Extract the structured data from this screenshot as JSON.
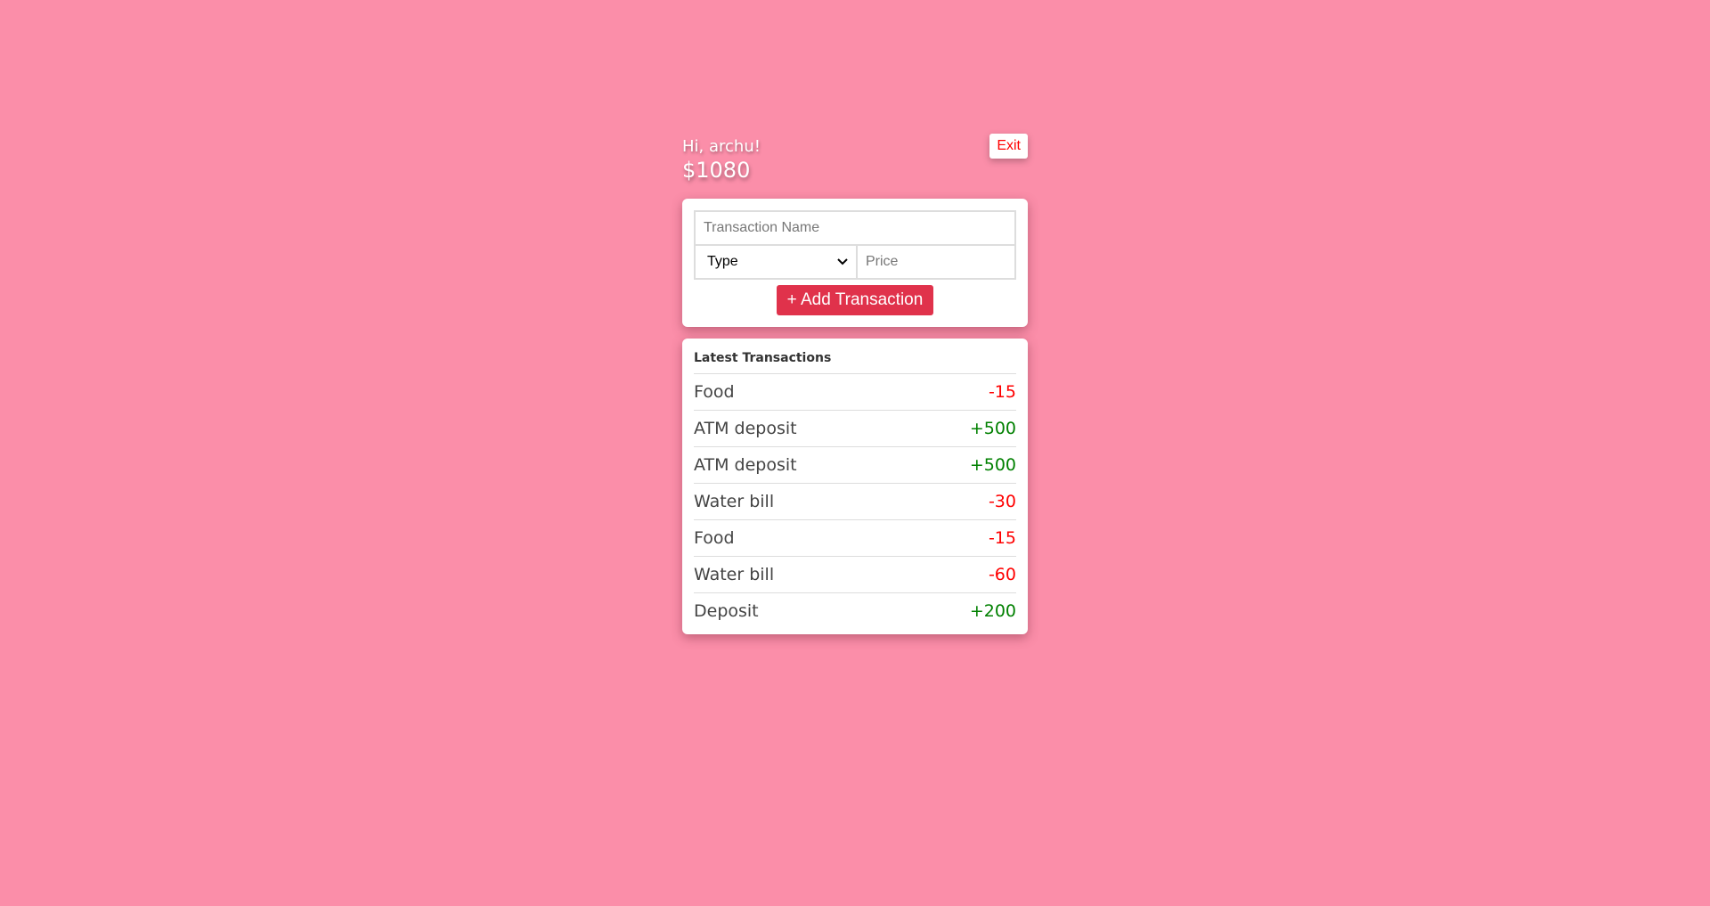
{
  "header": {
    "greeting": "Hi, archu!",
    "balance": "$1080",
    "exit_label": "Exit"
  },
  "form": {
    "name_placeholder": "Transaction Name",
    "type_value": "Type",
    "price_placeholder": "Price",
    "add_label": "+ Add Transaction"
  },
  "list": {
    "title": "Latest Transactions",
    "items": [
      {
        "name": "Food",
        "amount": "-15",
        "kind": "neg"
      },
      {
        "name": "ATM deposit",
        "amount": "+500",
        "kind": "pos"
      },
      {
        "name": "ATM deposit",
        "amount": "+500",
        "kind": "pos"
      },
      {
        "name": "Water bill",
        "amount": "-30",
        "kind": "neg"
      },
      {
        "name": "Food",
        "amount": "-15",
        "kind": "neg"
      },
      {
        "name": "Water bill",
        "amount": "-60",
        "kind": "neg"
      },
      {
        "name": "Deposit",
        "amount": "+200",
        "kind": "pos"
      }
    ]
  },
  "colors": {
    "background": "#fb8ea9",
    "accent": "#e0324b",
    "negative": "#ff0000",
    "positive": "#008000"
  }
}
